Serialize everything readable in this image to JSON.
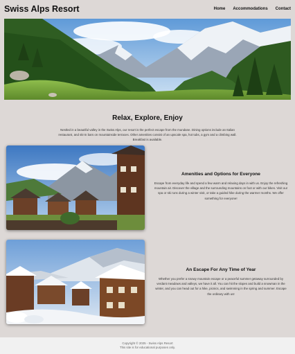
{
  "header": {
    "brand": "Swiss Alps Resort",
    "nav": [
      "Home",
      "Accommodations",
      "Contact"
    ]
  },
  "intro": {
    "title": "Relax, Explore, Enjoy",
    "text": "Nestled in a beautiful valley in the Swiss Alps, our resort is the perfect escape from the mundane. Dining options include an Italian restaurant, and ski-in bars on mountainside terraces. Other amenities consist of an upscale spa, hot tubs, a gym and a climbing wall. Breakfast is available."
  },
  "features": [
    {
      "title": "Amenities and Options for Everyone",
      "text": "Escape from everyday life and spend a few warm and relaxing days in with us. Enjoy the refreshing mountain air. Discover the village and the surrounding mountains on foot or with our bikes. Visit our spa or ski runs during a winter visit, or take a guided hike during the warmer months. We offer something for everyone!"
    },
    {
      "title": "An Escape For Any Time of Year",
      "text": "Whether you prefer a snowy mountain escape or a peaceful summer getaway surrounded by verdant meadows and valleys, we have it all. You can hit the slopes and build a snowman in the winter, and you can head out for a hike, picnics, and swimming in the spring and summer. Escape the ordinary with us!"
    }
  ],
  "footer": {
    "copyright": "Copyright © 2025 - Swiss Alps Resort",
    "note": "This site is for educational purposes only."
  }
}
